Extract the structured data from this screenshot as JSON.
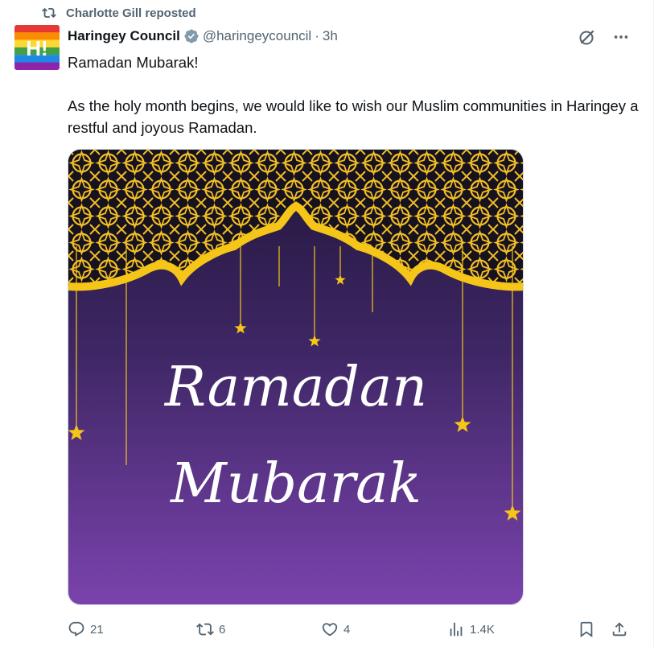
{
  "repost": {
    "text": "Charlotte Gill reposted",
    "icon": "repost-icon"
  },
  "author": {
    "name": "Haringey Council",
    "handle": "@haringeycouncil",
    "separator": "·",
    "time": "3h",
    "avatar_text": "H!",
    "verified_color": "#829aab"
  },
  "tweet": {
    "line1": "Ramadan Mubarak!",
    "line2": "As the holy month begins, we would like to wish our Muslim communities in Haringey a restful and joyous Ramadan."
  },
  "media": {
    "line1": "Ramadan",
    "line2": "Mubarak",
    "colors": {
      "gold": "#f5c518",
      "dark": "#1a1424",
      "purple_top": "#2b1d4a",
      "purple_bottom": "#7c44b0"
    }
  },
  "actions": {
    "replies": "21",
    "reposts": "6",
    "likes": "4",
    "views": "1.4K"
  },
  "colors": {
    "muted": "#536471",
    "text": "#0f1419",
    "accent": "#1d9bf0"
  }
}
